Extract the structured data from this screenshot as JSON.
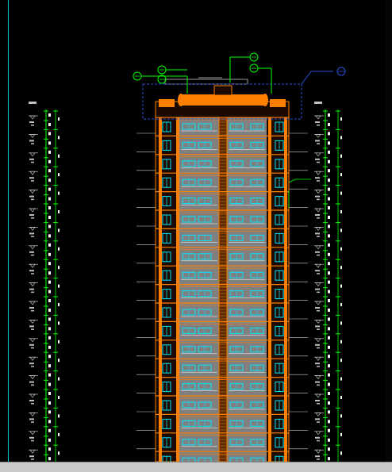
{
  "colors": {
    "background": "#000000",
    "elevation_outline": "#ff7f00",
    "wall_fill": "#808080",
    "window_cyan": "#00e5ff",
    "dimension_green": "#00ff00",
    "dimension_white": "#ffffff",
    "annotation_blue": "#2a4fd6",
    "status_bar": "#c9c9c9",
    "left_rule": "#00c8d0"
  },
  "drawing": {
    "type": "cad-building-elevation",
    "floor_count": 20,
    "icons": [
      "level-marker-icon",
      "axis-bubble-icon",
      "section-callout-icon"
    ]
  }
}
